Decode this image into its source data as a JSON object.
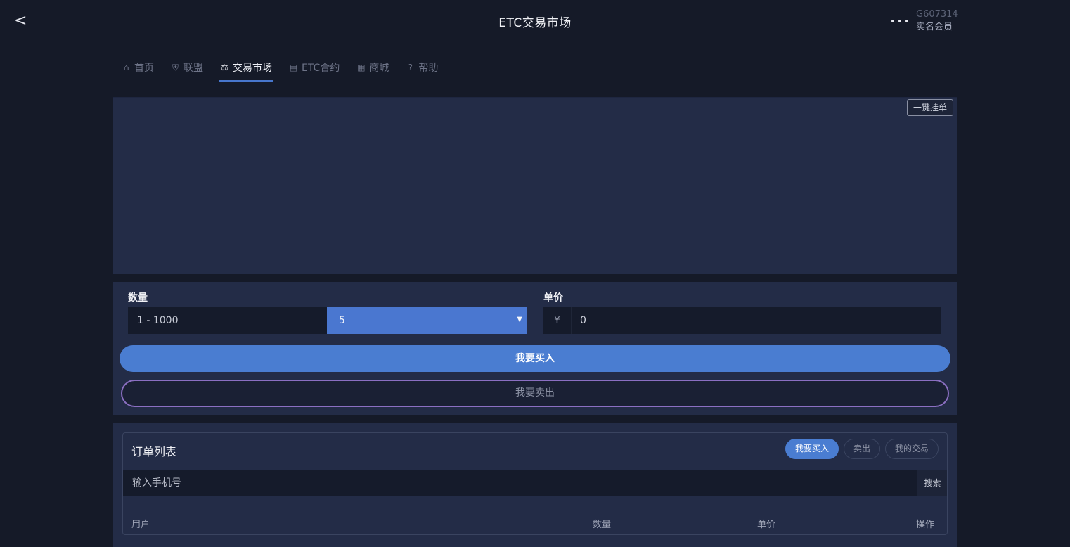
{
  "header": {
    "back_label": "<",
    "title": "ETC交易市场",
    "more_icon": "ellipsis-icon",
    "user_id": "G607314",
    "user_role": "实名会员"
  },
  "tabs": [
    {
      "label": "首页",
      "icon": "home-icon",
      "glyph": "⌂"
    },
    {
      "label": "联盟",
      "icon": "shield-icon",
      "glyph": "⛨"
    },
    {
      "label": "交易市场",
      "icon": "gavel-icon",
      "glyph": "⚖",
      "active": true
    },
    {
      "label": "ETC合约",
      "icon": "contract-icon",
      "glyph": "▤"
    },
    {
      "label": "商城",
      "icon": "store-icon",
      "glyph": "▦"
    },
    {
      "label": "帮助",
      "icon": "help-icon",
      "glyph": "?"
    }
  ],
  "chart": {
    "quick_order_label": "一键挂单"
  },
  "form": {
    "qty_label": "数量",
    "qty_placeholder": "1 - 1000",
    "qty_selected": "5",
    "price_label": "单价",
    "price_prefix": "¥",
    "price_value": "0",
    "buy_label": "我要买入",
    "sell_label": "我要卖出"
  },
  "orders": {
    "title": "订单列表",
    "filters": [
      {
        "label": "我要买入",
        "active": true
      },
      {
        "label": "卖出",
        "active": false
      },
      {
        "label": "我的交易",
        "active": false
      }
    ],
    "search_placeholder": "输入手机号",
    "search_button": "搜索",
    "columns": [
      "用户",
      "数量",
      "单价",
      "操作"
    ]
  },
  "colors": {
    "background": "#151a28",
    "panel": "#232c47",
    "accent": "#4a7dd1",
    "sell_border": "#8b6fc2"
  }
}
